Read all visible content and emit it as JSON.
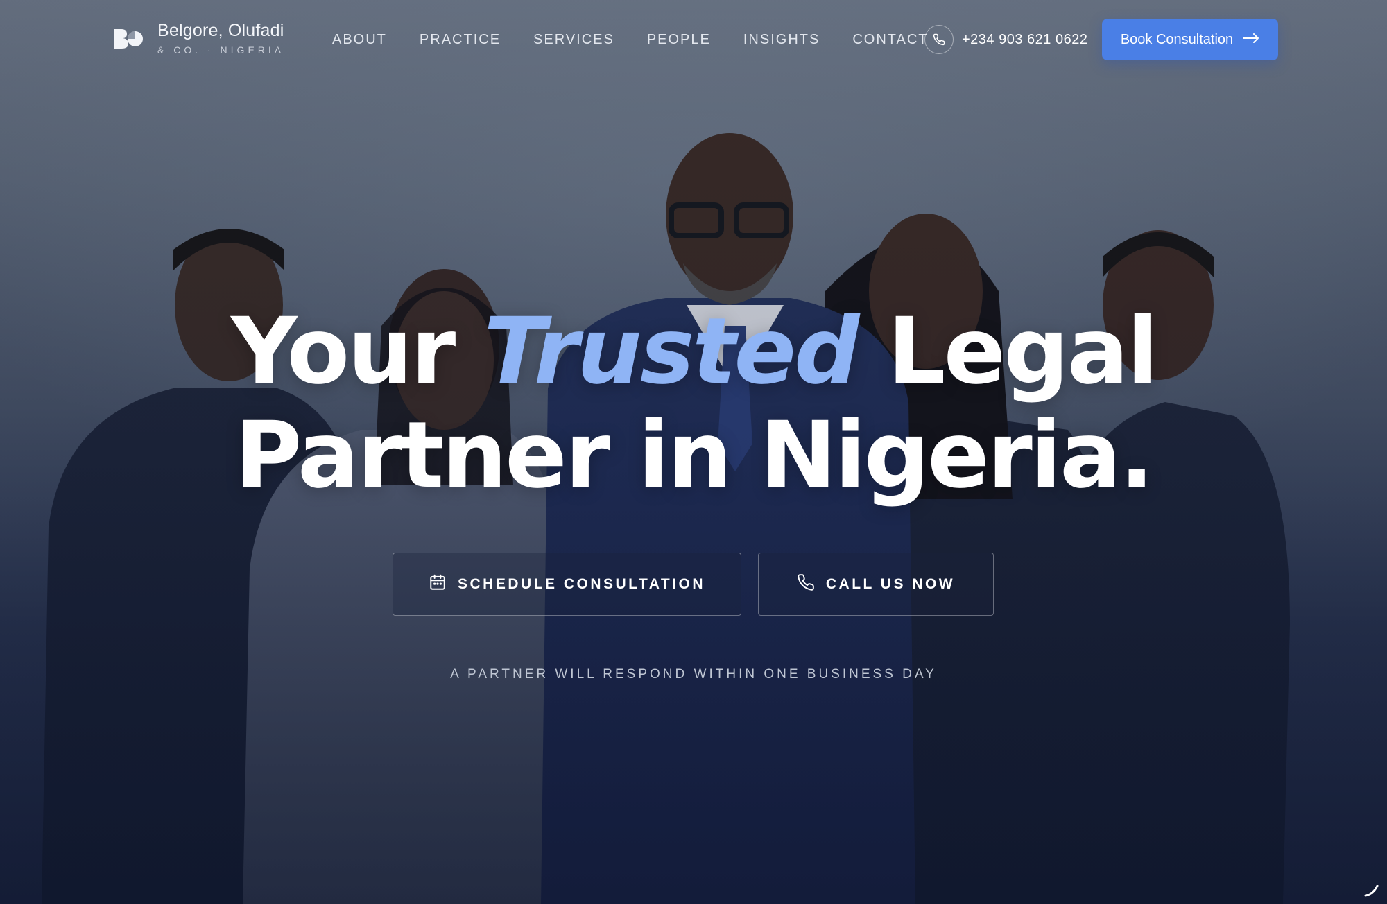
{
  "brand": {
    "name": "Belgore, Olufadi",
    "subtitle": "& CO. · NIGERIA"
  },
  "nav": {
    "links": [
      "ABOUT",
      "PRACTICE",
      "SERVICES",
      "PEOPLE",
      "INSIGHTS",
      "CONTACT"
    ],
    "phone": "+234 903 621 0622",
    "book_label": "Book Consultation",
    "book_arrow": "→"
  },
  "hero": {
    "headline_line1_a": "Your",
    "headline_line1_accent": "Trusted",
    "headline_line1_b": "Legal",
    "headline_line2": "Partner in Nigeria.",
    "cta_schedule": "SCHEDULE CONSULTATION",
    "cta_call": "CALL US NOW",
    "note": "A PARTNER WILL RESPOND WITHIN ONE BUSINESS DAY"
  },
  "colors": {
    "accent": "#4a7fe6",
    "headline_accent": "#8fb4f5"
  },
  "icons": {
    "phone": "phone-icon",
    "calendar": "calendar-icon",
    "arrow": "arrow-right-icon"
  }
}
